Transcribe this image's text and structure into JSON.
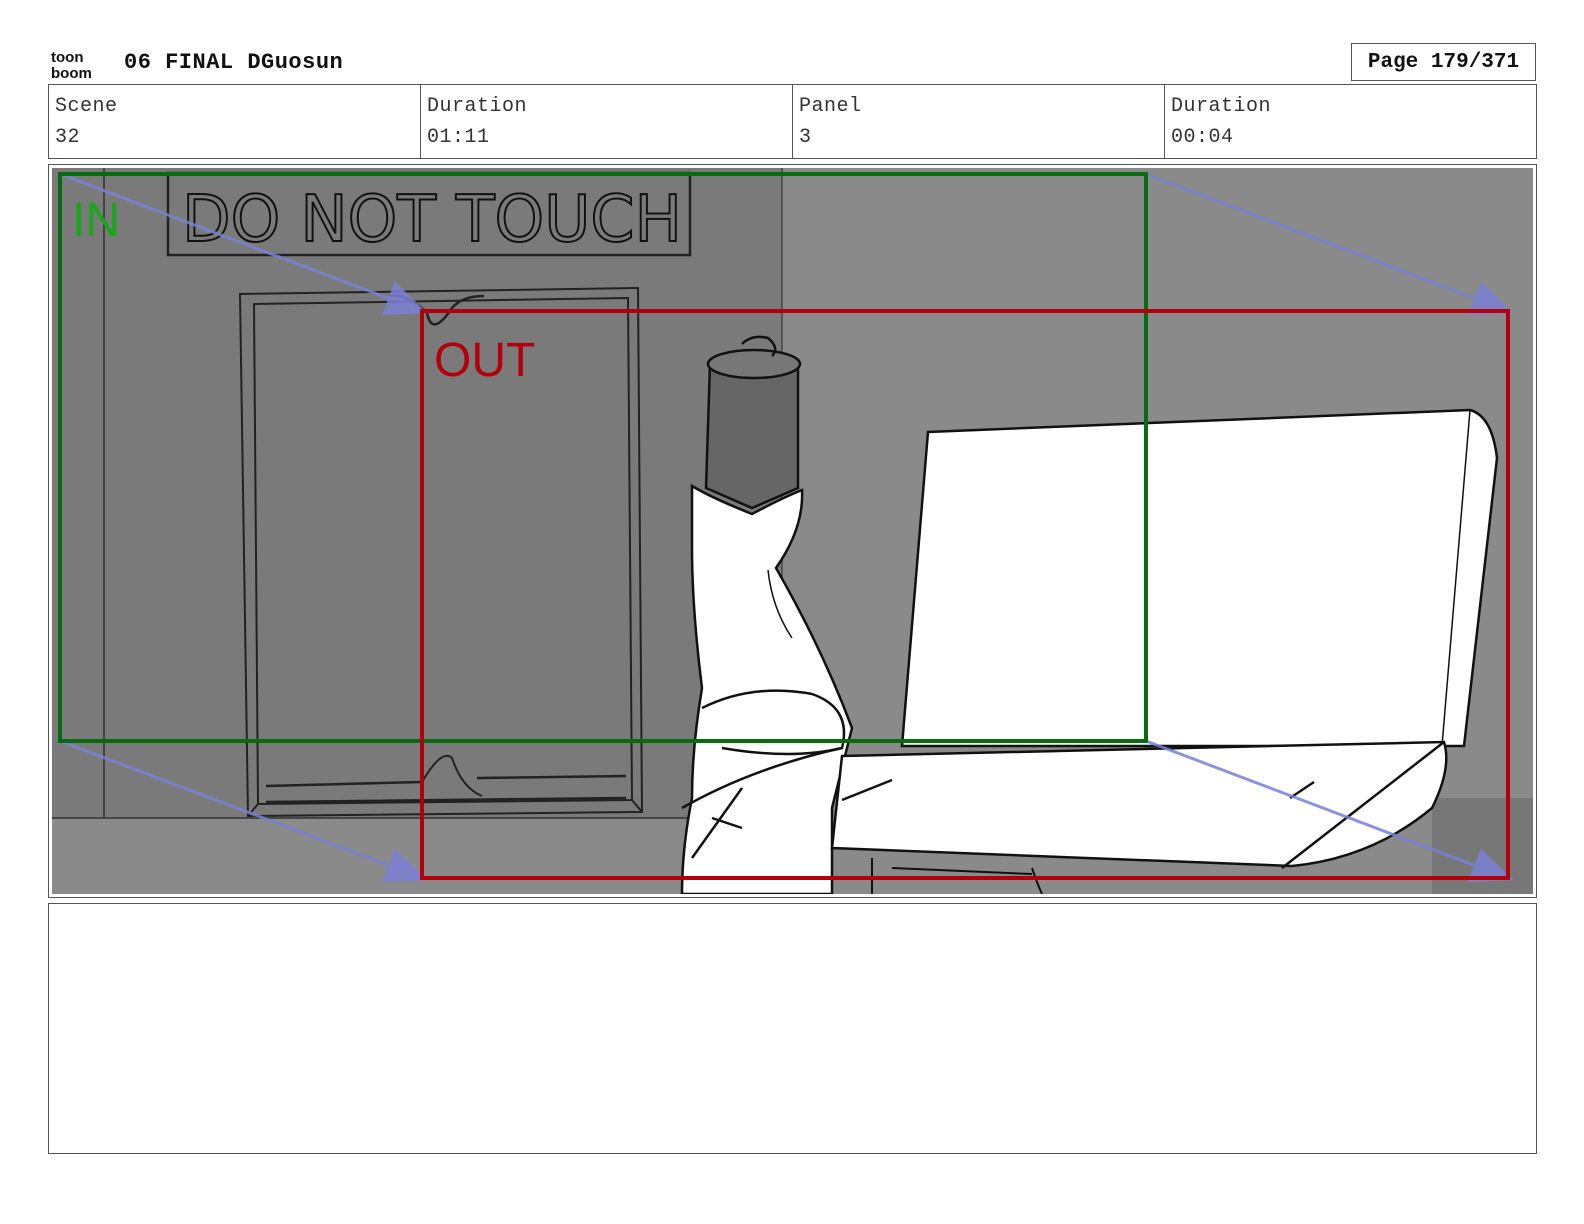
{
  "header": {
    "logo_text_top": "toon",
    "logo_text_bottom": "boom",
    "title": "06 FINAL DGuosun",
    "page_label": "Page 179/371"
  },
  "info": {
    "scene_label": "Scene",
    "scene_value": "32",
    "duration_label": "Duration",
    "duration_value": "01:11",
    "panel_label": "Panel",
    "panel_value": "3",
    "panel_duration_label": "Duration",
    "panel_duration_value": "00:04"
  },
  "panel": {
    "sign_text": "DO NOT TOUCH",
    "in_label": "IN",
    "out_label": "OUT",
    "colors": {
      "in_frame": "#0a6a12",
      "in_text": "#1aa51a",
      "out_frame": "#b3000d",
      "motion_arrow": "#7a80d6",
      "background": "#8a8a8a",
      "wall_dark": "#7a7a7a"
    }
  },
  "notes": {
    "text": ""
  }
}
